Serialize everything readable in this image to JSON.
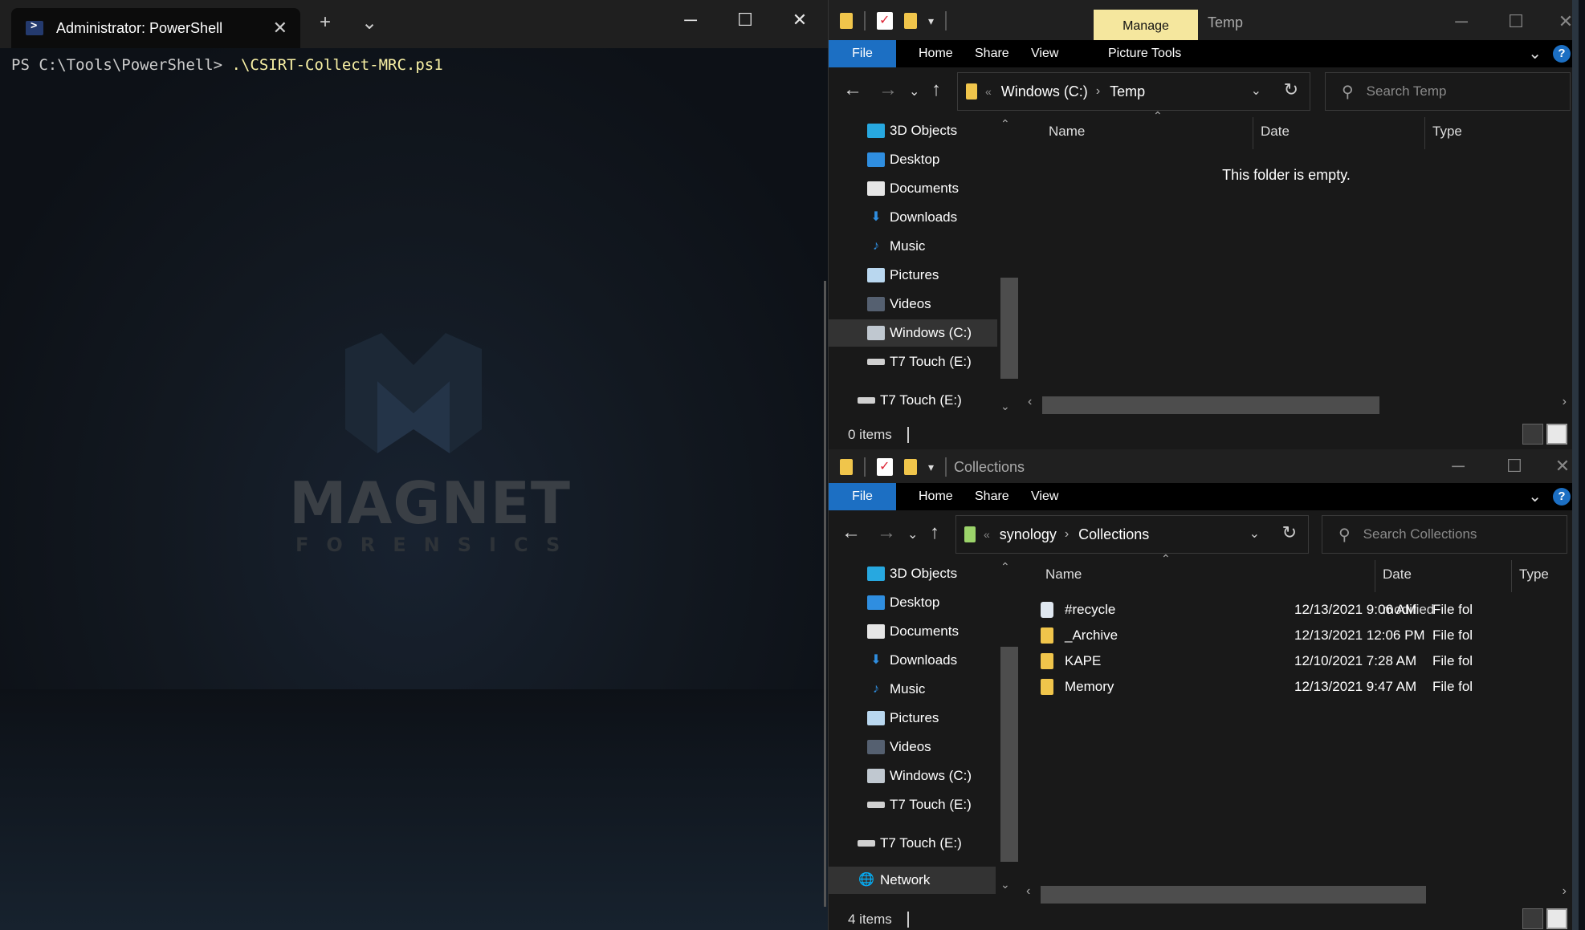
{
  "terminal": {
    "tab_title": "Administrator: PowerShell",
    "new_tab": "+",
    "dropdown": "⌄",
    "prompt": "PS C:\\Tools\\PowerShell> ",
    "command": ".\\CSIRT-Collect-MRC.ps1",
    "logo_text": "MAGNET",
    "logo_sub": "FORENSICS"
  },
  "explorer_temp": {
    "ribbon_tabs": [
      "File",
      "Home",
      "Share",
      "View",
      "Picture Tools"
    ],
    "manage_label": "Manage",
    "title": "Temp",
    "address": [
      "Windows (C:)",
      "Temp"
    ],
    "search_placeholder": "Search Temp",
    "nav_items": [
      "3D Objects",
      "Desktop",
      "Documents",
      "Downloads",
      "Music",
      "Pictures",
      "Videos",
      "Windows (C:)",
      "T7 Touch (E:)",
      "T7 Touch (E:)"
    ],
    "selected_nav": "Windows (C:)",
    "columns": [
      "Name",
      "Date",
      "Type"
    ],
    "empty_message": "This folder is empty.",
    "status": "0 items"
  },
  "explorer_collections": {
    "ribbon_tabs": [
      "File",
      "Home",
      "Share",
      "View"
    ],
    "title": "Collections",
    "address": [
      "synology",
      "Collections"
    ],
    "search_placeholder": "Search Collections",
    "nav_items": [
      "3D Objects",
      "Desktop",
      "Documents",
      "Downloads",
      "Music",
      "Pictures",
      "Videos",
      "Windows (C:)",
      "T7 Touch (E:)",
      "T7 Touch (E:)",
      "Network"
    ],
    "columns": [
      "Name",
      "Date modified",
      "Type"
    ],
    "files": [
      {
        "name": "#recycle",
        "date": "12/13/2021 9:06 AM",
        "type": "File fol",
        "icon": "recycle-icon"
      },
      {
        "name": "_Archive",
        "date": "12/13/2021 12:06 PM",
        "type": "File fol",
        "icon": "folder-icon"
      },
      {
        "name": "KAPE",
        "date": "12/10/2021 7:28 AM",
        "type": "File fol",
        "icon": "folder-icon"
      },
      {
        "name": "Memory",
        "date": "12/13/2021 9:47 AM",
        "type": "File fol",
        "icon": "folder-icon"
      }
    ],
    "status": "4 items"
  },
  "colors": {
    "accent": "#1c6fc3",
    "manage_tab": "#f5e79e",
    "folder": "#f0c54b",
    "terminal_bg": "#0c0c0c",
    "command_text": "#f9f1a5"
  }
}
